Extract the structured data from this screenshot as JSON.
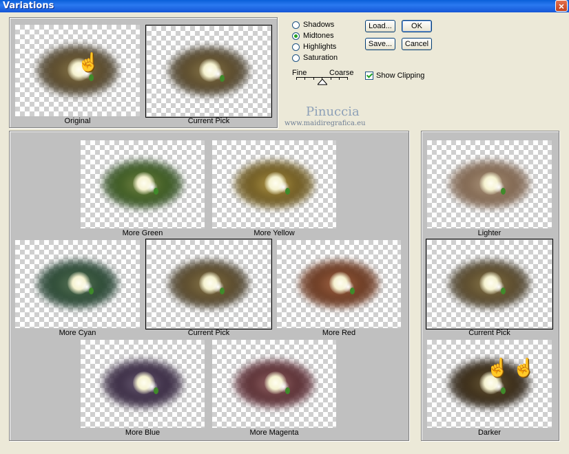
{
  "window": {
    "title": "Variations",
    "close_symbol": "×"
  },
  "preview": {
    "original_label": "Original",
    "current_label": "Current Pick"
  },
  "channels": {
    "options": [
      "Shadows",
      "Midtones",
      "Highlights",
      "Saturation"
    ],
    "selected": "Midtones"
  },
  "buttons": {
    "load": "Load...",
    "ok": "OK",
    "save": "Save...",
    "cancel": "Cancel"
  },
  "fine_coarse": {
    "fine": "Fine",
    "coarse": "Coarse"
  },
  "show_clipping": {
    "label": "Show Clipping",
    "checked": true
  },
  "watermark": {
    "name": "Pinuccia",
    "url": "www.maidiregrafica.eu"
  },
  "hues": {
    "more_green": "More Green",
    "more_yellow": "More Yellow",
    "more_cyan": "More Cyan",
    "current_pick": "Current Pick",
    "more_red": "More Red",
    "more_blue": "More Blue",
    "more_magenta": "More Magenta"
  },
  "brightness": {
    "lighter": "Lighter",
    "current_pick": "Current Pick",
    "darker": "Darker"
  },
  "colors": {
    "titlebar": "#1556d6",
    "panel": "#c0c0c0",
    "dialog": "#ece9d8",
    "radio_dot": "#21a121"
  }
}
